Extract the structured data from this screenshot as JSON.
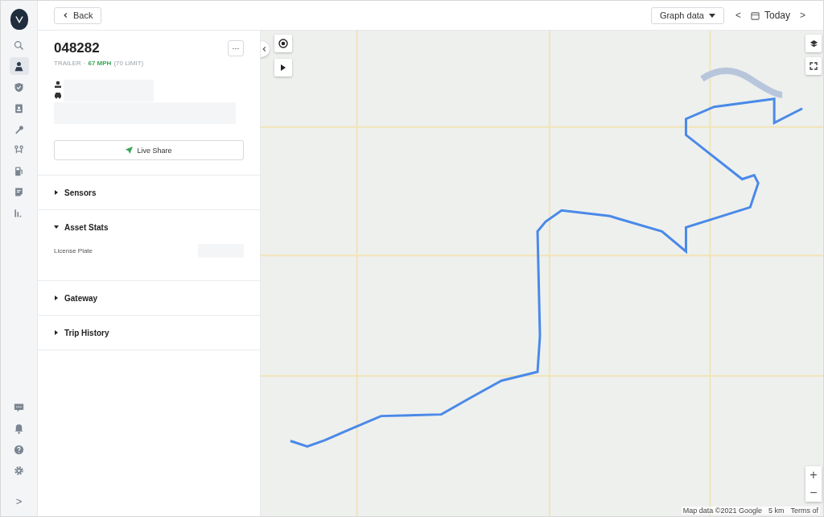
{
  "nav": {
    "items": [
      {
        "selected": false
      },
      {
        "selected": true
      },
      {
        "selected": false
      },
      {
        "selected": false
      },
      {
        "selected": false
      },
      {
        "selected": false
      },
      {
        "selected": false
      },
      {
        "selected": false
      },
      {
        "selected": false
      }
    ],
    "expand": ">"
  },
  "top_bar": {
    "back": "Back",
    "graph_button": "Graph data",
    "prev": "<",
    "date": "Today",
    "next": ">"
  },
  "asset": {
    "name": "048282",
    "type": "TRAILER",
    "separator": "·",
    "speed": "67 MPH",
    "limit": "(70 LIMIT)",
    "more": "···",
    "live_share": "Live Share"
  },
  "sections": [
    {
      "title": "Sensors",
      "expanded": false
    },
    {
      "title": "Asset Stats",
      "expanded": true,
      "rows": [
        {
          "label": "License Plate"
        }
      ]
    },
    {
      "title": "Gateway",
      "expanded": false
    },
    {
      "title": "Trip History",
      "expanded": false
    }
  ],
  "map": {
    "zoom_in": "+",
    "zoom_out": "−",
    "attribution": "Map data ©2021 Google",
    "scale": "5 km",
    "terms": "Terms of"
  }
}
